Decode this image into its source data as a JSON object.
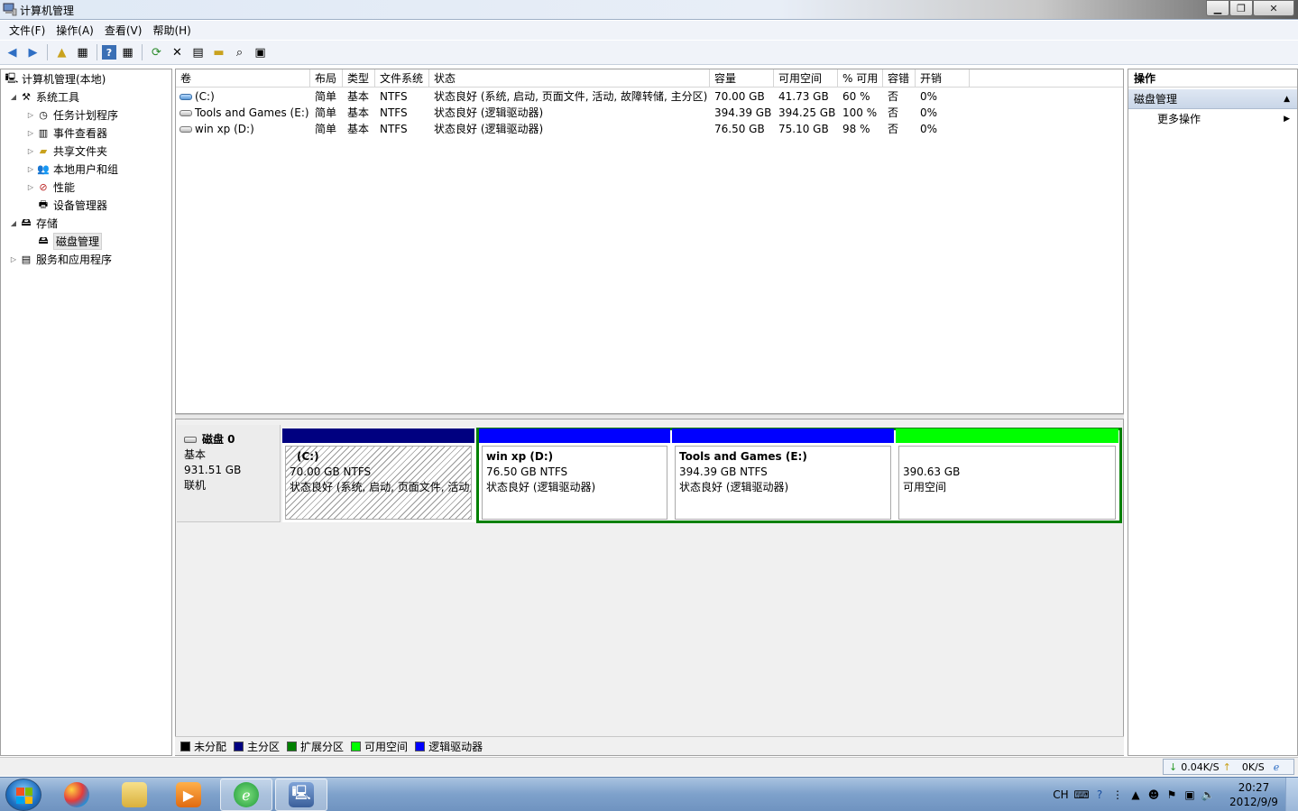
{
  "window": {
    "title": "计算机管理"
  },
  "menu": [
    "文件(F)",
    "操作(A)",
    "查看(V)",
    "帮助(H)"
  ],
  "tree": [
    {
      "label": "计算机管理(本地)",
      "icon": "computer-icon",
      "indent": 0,
      "arrow": ""
    },
    {
      "label": "系统工具",
      "icon": "tools-icon",
      "indent": 1,
      "arrow": "◢"
    },
    {
      "label": "任务计划程序",
      "icon": "clock-icon",
      "indent": 2,
      "arrow": "▷"
    },
    {
      "label": "事件查看器",
      "icon": "event-viewer-icon",
      "indent": 2,
      "arrow": "▷"
    },
    {
      "label": "共享文件夹",
      "icon": "shared-folder-icon",
      "indent": 2,
      "arrow": "▷"
    },
    {
      "label": "本地用户和组",
      "icon": "users-icon",
      "indent": 2,
      "arrow": "▷"
    },
    {
      "label": "性能",
      "icon": "performance-icon",
      "indent": 2,
      "arrow": "▷"
    },
    {
      "label": "设备管理器",
      "icon": "device-manager-icon",
      "indent": 2,
      "arrow": ""
    },
    {
      "label": "存储",
      "icon": "storage-icon",
      "indent": 1,
      "arrow": "◢"
    },
    {
      "label": "磁盘管理",
      "icon": "disk-icon",
      "indent": 2,
      "arrow": "",
      "selected": true
    },
    {
      "label": "服务和应用程序",
      "icon": "services-icon",
      "indent": 1,
      "arrow": "▷"
    }
  ],
  "volumes": {
    "columns": [
      "卷",
      "布局",
      "类型",
      "文件系统",
      "状态",
      "容量",
      "可用空间",
      "% 可用",
      "容错",
      "开销"
    ],
    "rows": [
      [
        "(C:)",
        "简单",
        "基本",
        "NTFS",
        "状态良好 (系统, 启动, 页面文件, 活动, 故障转储, 主分区)",
        "70.00 GB",
        "41.73 GB",
        "60 %",
        "否",
        "0%"
      ],
      [
        "Tools and Games (E:)",
        "简单",
        "基本",
        "NTFS",
        "状态良好 (逻辑驱动器)",
        "394.39 GB",
        "394.25 GB",
        "100 %",
        "否",
        "0%"
      ],
      [
        "win xp (D:)",
        "简单",
        "基本",
        "NTFS",
        "状态良好 (逻辑驱动器)",
        "76.50 GB",
        "75.10 GB",
        "98 %",
        "否",
        "0%"
      ]
    ]
  },
  "disk": {
    "name": "磁盘 0",
    "type": "基本",
    "size": "931.51 GB",
    "status": "联机",
    "partitions": [
      {
        "name": "(C:)",
        "size": "70.00 GB NTFS",
        "status": "状态良好 (系统, 启动, 页面文件, 活动,",
        "color": "#000080"
      },
      {
        "name": "win xp  (D:)",
        "size": "76.50 GB NTFS",
        "status": "状态良好 (逻辑驱动器)",
        "color": "#0000ff"
      },
      {
        "name": "Tools and Games  (E:)",
        "size": "394.39 GB NTFS",
        "status": "状态良好 (逻辑驱动器)",
        "color": "#0000ff"
      },
      {
        "name": "",
        "size": "390.63 GB",
        "status": "可用空间",
        "color": "#00ff00"
      }
    ]
  },
  "legend": [
    {
      "label": "未分配",
      "color": "#000000"
    },
    {
      "label": "主分区",
      "color": "#000080"
    },
    {
      "label": "扩展分区",
      "color": "#008000"
    },
    {
      "label": "可用空间",
      "color": "#00ff00"
    },
    {
      "label": "逻辑驱动器",
      "color": "#0000ff"
    }
  ],
  "actions": {
    "header": "操作",
    "section": "磁盘管理",
    "item": "更多操作"
  },
  "netspeed": {
    "down": "0.04K/S",
    "up": "0K/S"
  },
  "tray": {
    "lang": "CH",
    "time": "20:27",
    "date": "2012/9/9"
  }
}
